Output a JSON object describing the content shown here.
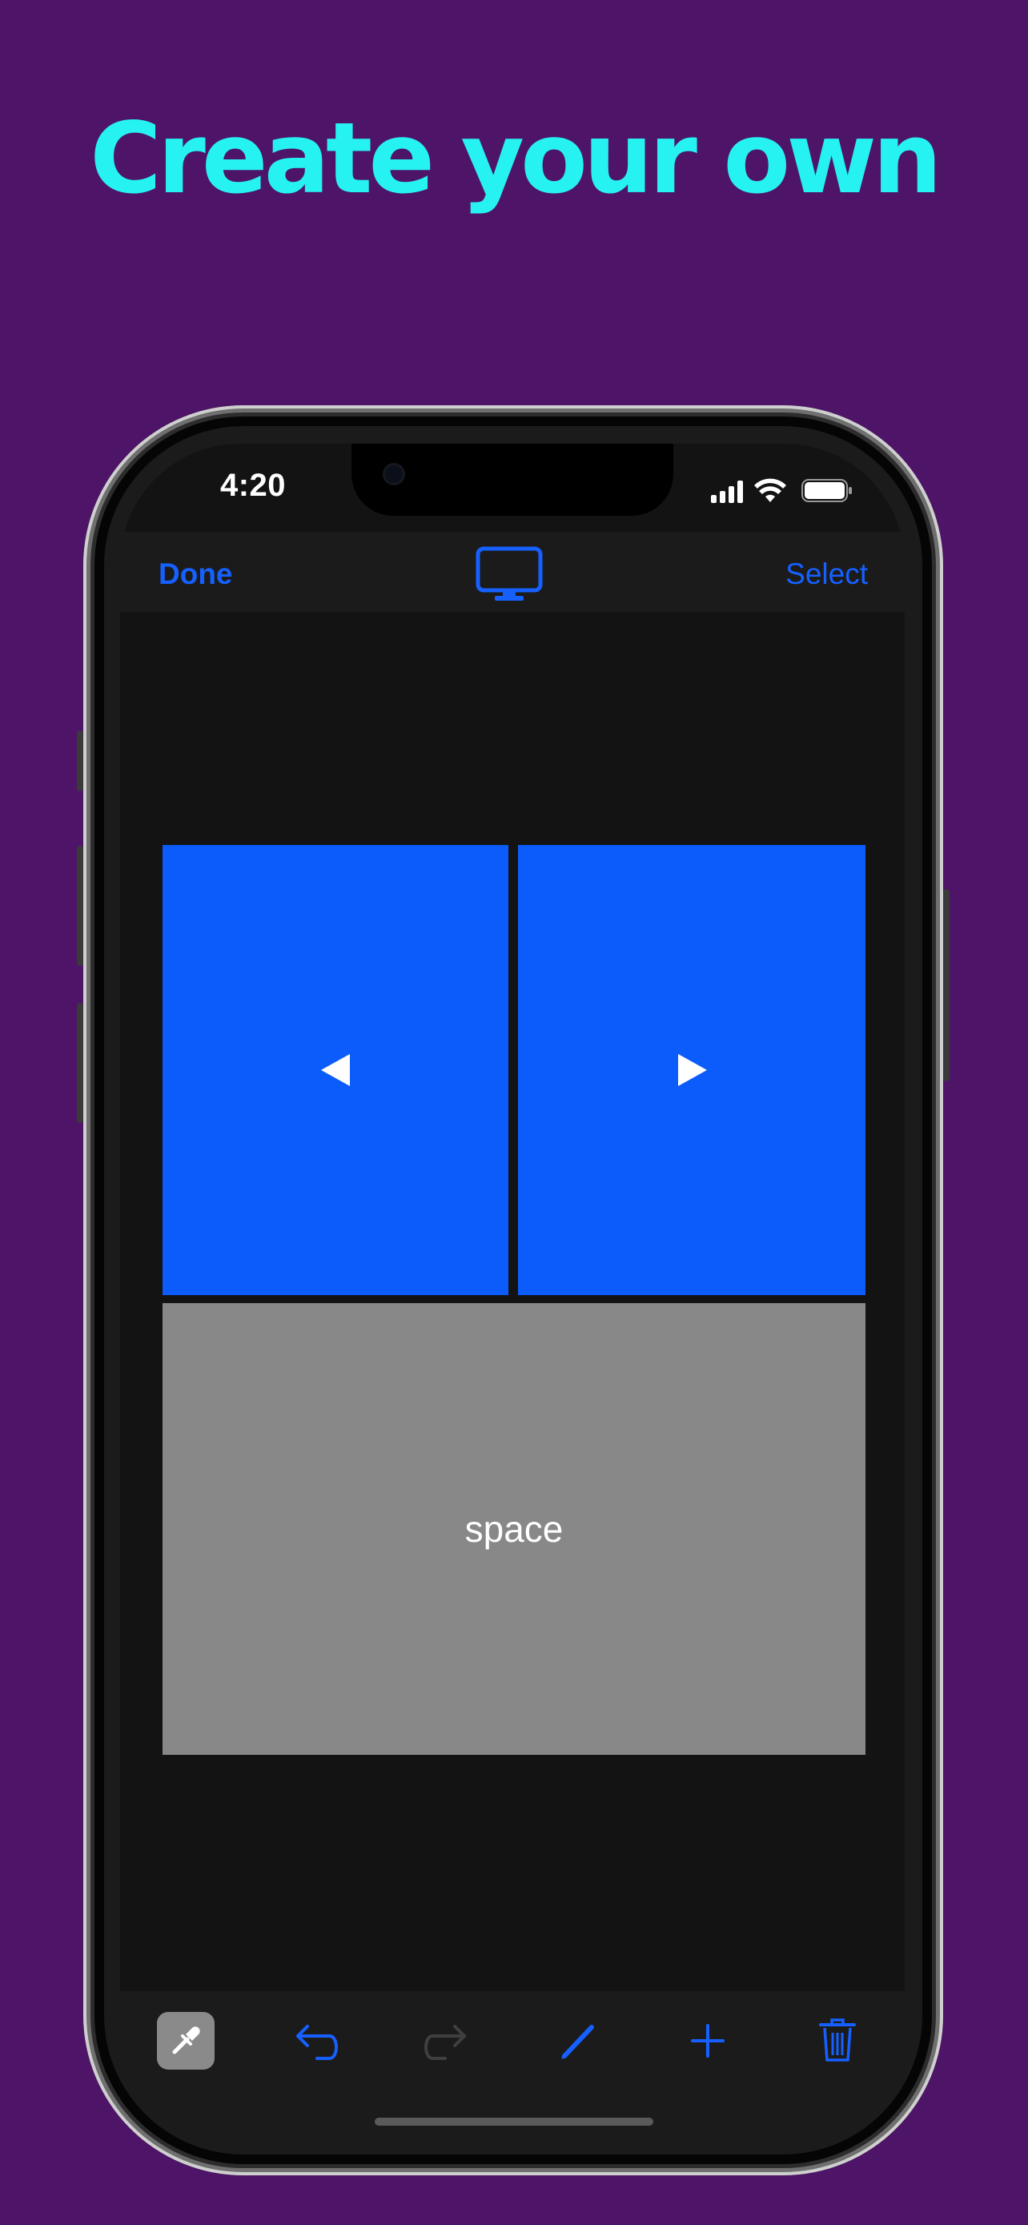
{
  "headline": "Create your own",
  "status": {
    "time": "4:20"
  },
  "nav": {
    "left_label": "Done",
    "right_label": "Select",
    "center_icon": "monitor-icon"
  },
  "tiles": [
    {
      "name": "left-arrow-tile",
      "icon": "triangle-left-icon",
      "color": "#0c5cfb"
    },
    {
      "name": "right-arrow-tile",
      "icon": "triangle-right-icon",
      "color": "#0c5cfb"
    },
    {
      "name": "space-tile",
      "label": "space",
      "color": "#888888"
    }
  ],
  "toolbar": {
    "items": [
      "eyedropper-icon",
      "undo-icon",
      "redo-icon",
      "pencil-icon",
      "plus-icon",
      "trash-icon"
    ]
  },
  "colors": {
    "background": "#4e1468",
    "headline": "#27f2f2",
    "accent": "#1560ff",
    "tile_blue": "#0c5cfb",
    "tile_grey": "#888888",
    "screen": "#131313"
  }
}
